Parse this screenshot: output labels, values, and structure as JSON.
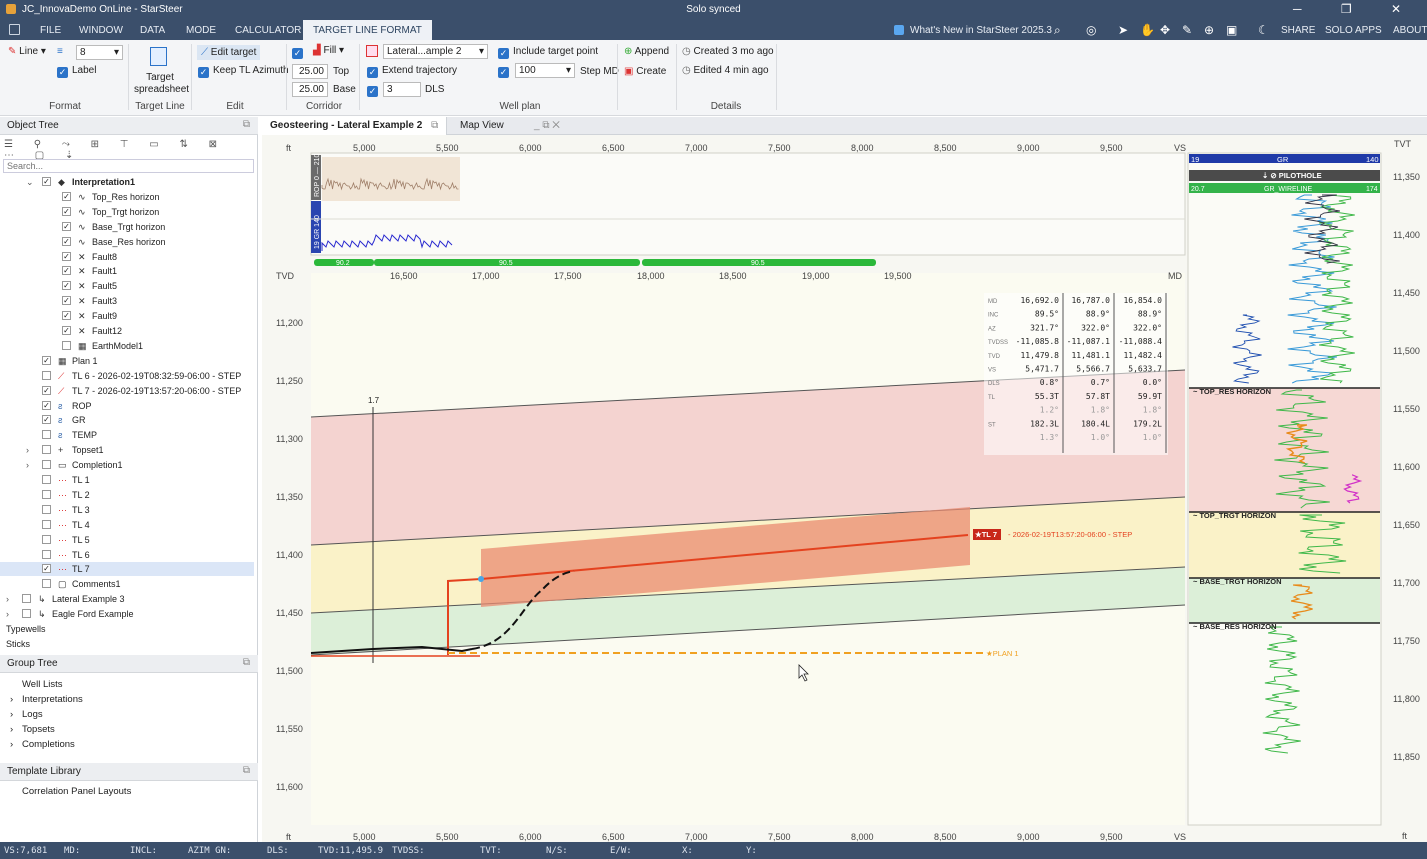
{
  "app": {
    "title": "JC_InnovaDemo OnLine - StarSteer",
    "sync_status": "Solo synced",
    "window_controls": "─ ❐ ✕"
  },
  "menu": {
    "items": [
      "FILE",
      "WINDOW",
      "DATA",
      "MODE",
      "CALCULATOR",
      "TARGET LINE FORMAT"
    ],
    "whats_new": "What's New in StarSteer 2025.3",
    "right": [
      "SHARE",
      "SOLO APPS",
      "ABOUT"
    ]
  },
  "ribbon": {
    "line_label": "Line",
    "line_width": "8",
    "label_cb": "Label",
    "group_format": "Format",
    "target_spreadsheet": "Target spreadsheet",
    "group_target_line": "Target Line",
    "edit_target": "Edit target",
    "keep_tl_azimuth": "Keep TL Azimuth",
    "group_edit": "Edit",
    "fill": "Fill",
    "top_value": "25.00",
    "top_label": "Top",
    "base_value": "25.00",
    "base_label": "Base",
    "group_corridor": "Corridor",
    "lateral_select": "Lateral...ample 2",
    "extend_trajectory": "Extend trajectory",
    "dls_value": "3",
    "dls_label": "DLS",
    "include_target_point": "Include target point",
    "step_value": "100",
    "step_md": "Step MD",
    "group_well_plan": "Well plan",
    "append": "Append",
    "create": "Create",
    "created_label": "Created",
    "created_value": "3 mo ago",
    "edited_label": "Edited",
    "edited_value": "4 min ago",
    "group_details": "Details"
  },
  "object_tree": {
    "title": "Object Tree",
    "search_placeholder": "Search...",
    "items": [
      {
        "label": "Interpretation1",
        "bold": true
      },
      {
        "label": "Top_Res horizon"
      },
      {
        "label": "Top_Trgt horizon"
      },
      {
        "label": "Base_Trgt horizon"
      },
      {
        "label": "Base_Res horizon"
      },
      {
        "label": "Fault8"
      },
      {
        "label": "Fault1"
      },
      {
        "label": "Fault5"
      },
      {
        "label": "Fault3"
      },
      {
        "label": "Fault9"
      },
      {
        "label": "Fault12"
      },
      {
        "label": "EarthModel1"
      },
      {
        "label": "Plan 1"
      },
      {
        "label": "TL 6 - 2026-02-19T08:32:59-06:00 - STEP"
      },
      {
        "label": "TL 7 - 2026-02-19T13:57:20-06:00 - STEP"
      },
      {
        "label": "ROP"
      },
      {
        "label": "GR"
      },
      {
        "label": "TEMP"
      },
      {
        "label": "Topset1"
      },
      {
        "label": "Completion1"
      },
      {
        "label": "TL 1"
      },
      {
        "label": "TL 2"
      },
      {
        "label": "TL 3"
      },
      {
        "label": "TL 4"
      },
      {
        "label": "TL 5"
      },
      {
        "label": "TL 6"
      },
      {
        "label": "TL 7"
      },
      {
        "label": "Comments1"
      },
      {
        "label": "Lateral Example 3"
      },
      {
        "label": "Eagle Ford Example"
      },
      {
        "label": "Typewells"
      },
      {
        "label": "Sticks"
      }
    ]
  },
  "group_tree": {
    "title": "Group Tree",
    "items": [
      "Well Lists",
      "Interpretations",
      "Logs",
      "Topsets",
      "Completions"
    ]
  },
  "template_library": {
    "title": "Template Library",
    "items": [
      "Correlation Panel Layouts"
    ]
  },
  "tabs": {
    "active": "Geosteering - Lateral Example 2",
    "other": "Map View"
  },
  "view": {
    "vs_unit": "ft",
    "vs_end": "VS",
    "md_unit": "MD",
    "tvd_unit": "TVD",
    "tvt_unit": "TVT",
    "vs_ticks": [
      "5,000",
      "5,500",
      "6,000",
      "6,500",
      "7,000",
      "7,500",
      "8,000",
      "8,500",
      "9,000",
      "9,500"
    ],
    "md_ticks": [
      "16,500",
      "17,000",
      "17,500",
      "18,000",
      "18,500",
      "19,000",
      "19,500"
    ],
    "tvd_ticks": [
      "11,200",
      "11,250",
      "11,300",
      "11,350",
      "11,400",
      "11,450",
      "11,500",
      "11,550",
      "11,600"
    ],
    "tvt_ticks": [
      "11,350",
      "11,400",
      "11,450",
      "11,500",
      "11,550",
      "11,600",
      "11,650",
      "11,700",
      "11,750",
      "11,800",
      "11,850"
    ],
    "rop_track": {
      "label": "ROP",
      "min": "0",
      "max": "210"
    },
    "gr_track": {
      "label": "GR",
      "min": "19",
      "max": "140"
    },
    "incl_bars": [
      "90.2",
      "90.5",
      "90.5"
    ],
    "marker_17": "1.7",
    "tl7_label": "TL 7",
    "tl7_desc": "- 2026-02-19T13:57:20-06:00 - STEP",
    "plan_label": "PLAN 1",
    "info_table": {
      "rows": [
        {
          "k": "MD",
          "v": [
            "16,692.0",
            "16,787.0",
            "16,854.0"
          ]
        },
        {
          "k": "INC",
          "v": [
            "89.5°",
            "88.9°",
            "88.9°"
          ]
        },
        {
          "k": "AZ",
          "v": [
            "321.7°",
            "322.0°",
            "322.0°"
          ]
        },
        {
          "k": "TVDSS",
          "v": [
            "-11,085.8",
            "-11,087.1",
            "-11,088.4"
          ]
        },
        {
          "k": "TVD",
          "v": [
            "11,479.8",
            "11,481.1",
            "11,482.4"
          ]
        },
        {
          "k": "VS",
          "v": [
            "5,471.7",
            "5,566.7",
            "5,633.7"
          ]
        },
        {
          "k": "DLS",
          "v": [
            "0.8°",
            "0.7°",
            "0.0°"
          ]
        },
        {
          "k": "TL",
          "v": [
            "55.3T",
            "57.8T",
            "59.9T"
          ]
        },
        {
          "k": "",
          "v": [
            "1.2°",
            "1.8°",
            "1.8°"
          ]
        },
        {
          "k": "ST",
          "v": [
            "182.3L",
            "180.4L",
            "179.2L"
          ]
        },
        {
          "k": "",
          "v": [
            "1.3°",
            "1.0°",
            "1.0°"
          ]
        }
      ]
    }
  },
  "typewell": {
    "gr_label": "GR",
    "gr_min": "19",
    "gr_max": "140",
    "pilothole": "PILOTHOLE",
    "wireline": "GR_WIRELINE",
    "wl_min": "20.7",
    "wl_max": "174",
    "horizons": [
      "TOP_RES HORIZON",
      "TOP_TRGT HORIZON",
      "BASE_TRGT HORIZON",
      "BASE_RES HORIZON"
    ]
  },
  "statusbar": {
    "items": [
      "VS:7,681",
      "MD:",
      "INCL:",
      "AZIM GN:",
      "DLS:",
      "TVD:11,495.9",
      "TVDSS:",
      "TVT:",
      "N/S:",
      "E/W:",
      "X:",
      "Y:"
    ]
  },
  "colors": {
    "titlebar": "#3b4f6b",
    "accent": "#2b73c9",
    "tl7": "#e4421f",
    "plan": "#f0a020",
    "incl_bar": "#2bb83a",
    "res_zone": "#f4d3d0",
    "trgt_zone": "#faf2c8",
    "base_zone": "#dcefd8"
  }
}
